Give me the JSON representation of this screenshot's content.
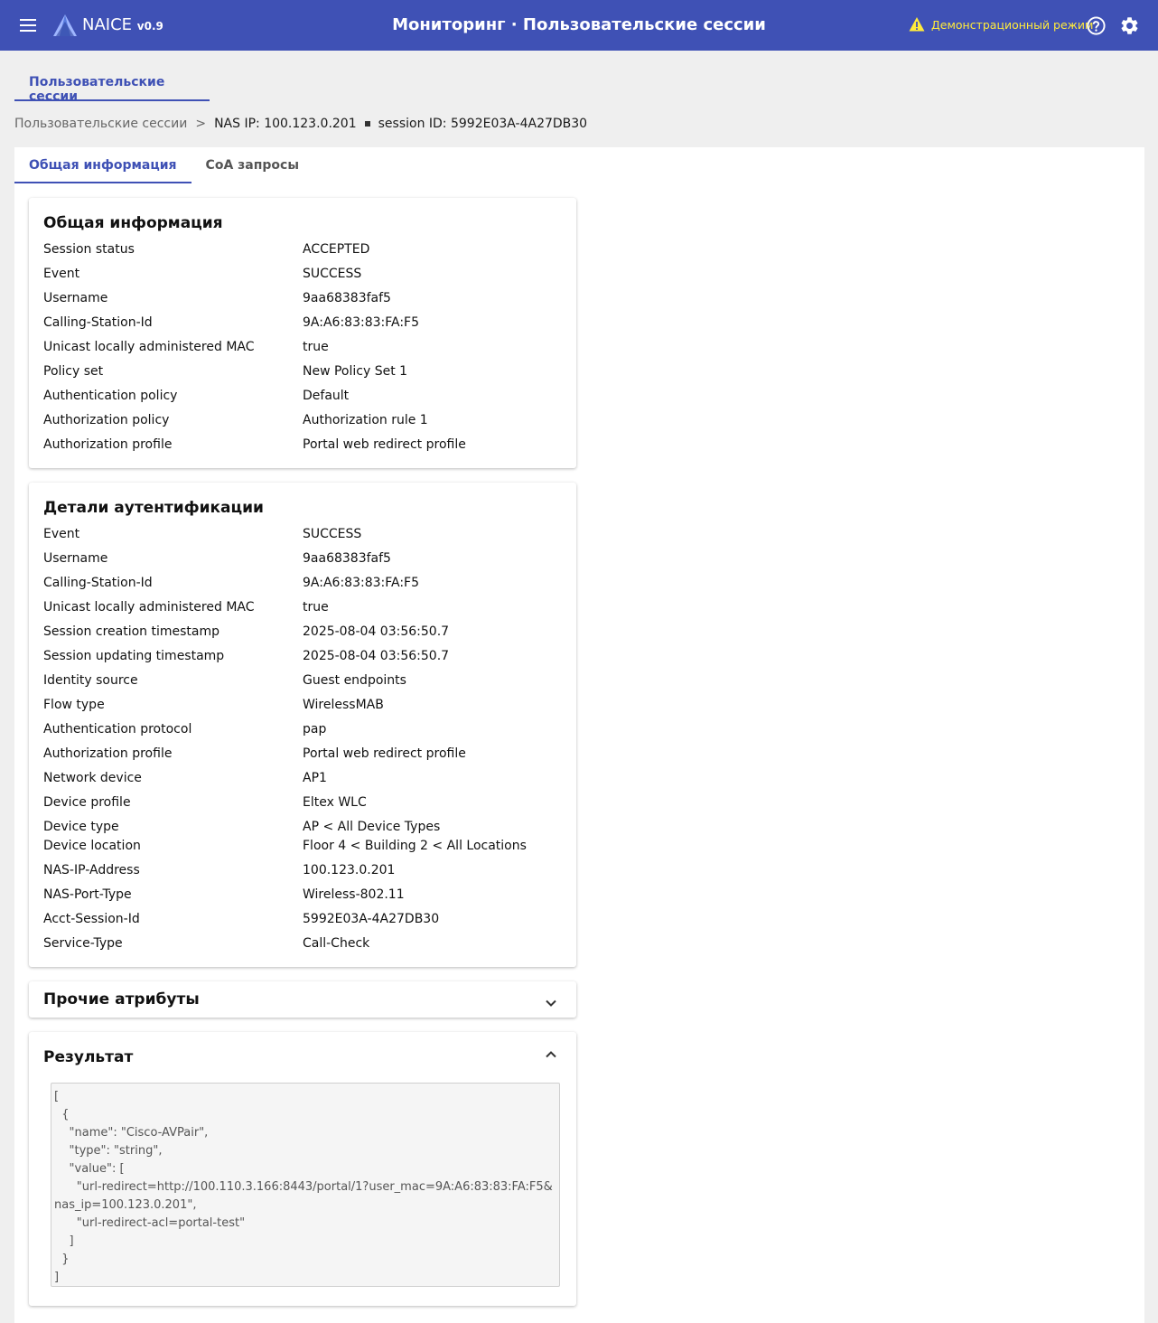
{
  "header": {
    "brand": "NAICE",
    "version": "v0.9",
    "title": "Мониторинг · Пользовательские сессии",
    "demo_label": "Демонстрационный режим",
    "accent": "#3f51b5",
    "demo_color": "#ffeb3b"
  },
  "section_tab": "Пользовательские сессии",
  "breadcrumb": {
    "root": "Пользовательские сессии",
    "separator": ">",
    "nas": "NAS IP: 100.123.0.201",
    "session": "session ID: 5992E03A-4A27DB30"
  },
  "tabs": [
    "Общая информация",
    "CoA запросы"
  ],
  "general": {
    "title": "Общая информация",
    "rows": [
      {
        "key": "Session status",
        "value": "ACCEPTED"
      },
      {
        "key": "Event",
        "value": "SUCCESS"
      },
      {
        "key": "Username",
        "value": "9aa68383faf5"
      },
      {
        "key": "Calling-Station-Id",
        "value": "9A:A6:83:83:FA:F5"
      },
      {
        "key": "Unicast locally administered MAC",
        "value": "true"
      },
      {
        "key": "Policy set",
        "value": "New Policy Set 1"
      },
      {
        "key": "Authentication policy",
        "value": "Default"
      },
      {
        "key": "Authorization policy",
        "value": "Authorization rule 1"
      },
      {
        "key": "Authorization profile",
        "value": "Portal web redirect profile"
      }
    ]
  },
  "auth": {
    "title": "Детали аутентификации",
    "rows": [
      {
        "key": "Event",
        "value": "SUCCESS"
      },
      {
        "key": "Username",
        "value": "9aa68383faf5"
      },
      {
        "key": "Calling-Station-Id",
        "value": "9A:A6:83:83:FA:F5"
      },
      {
        "key": "Unicast locally administered MAC",
        "value": "true"
      },
      {
        "key": "Session creation timestamp",
        "value": "2025-08-04 03:56:50.7"
      },
      {
        "key": "Session updating timestamp",
        "value": "2025-08-04 03:56:50.7"
      },
      {
        "key": "Identity source",
        "value": "Guest endpoints"
      },
      {
        "key": "Flow type",
        "value": "WirelessMAB"
      },
      {
        "key": "Authentication protocol",
        "value": "pap"
      },
      {
        "key": "Authorization profile",
        "value": "Portal web redirect profile"
      },
      {
        "key": "Network device",
        "value": "AP1"
      },
      {
        "key": "Device profile",
        "value": "Eltex WLC"
      },
      {
        "key": "Device type",
        "value": "AP < All Device Types"
      },
      {
        "key": "Device location",
        "value": "Floor 4 < Building 2 < All Locations"
      },
      {
        "key": "NAS-IP-Address",
        "value": "100.123.0.201"
      },
      {
        "key": "NAS-Port-Type",
        "value": "Wireless-802.11"
      },
      {
        "key": "Acct-Session-Id",
        "value": "5992E03A-4A27DB30"
      },
      {
        "key": "Service-Type",
        "value": "Call-Check"
      }
    ]
  },
  "other": {
    "title": "Прочие атрибуты"
  },
  "result": {
    "title": "Результат",
    "code": "[\n  {\n    \"name\": \"Cisco-AVPair\",\n    \"type\": \"string\",\n    \"value\": [\n      \"url-redirect=http://100.110.3.166:8443/portal/1?user_mac=9A:A6:83:83:FA:F5&nas_ip=100.123.0.201\",\n      \"url-redirect-acl=portal-test\"\n    ]\n  }\n]"
  }
}
